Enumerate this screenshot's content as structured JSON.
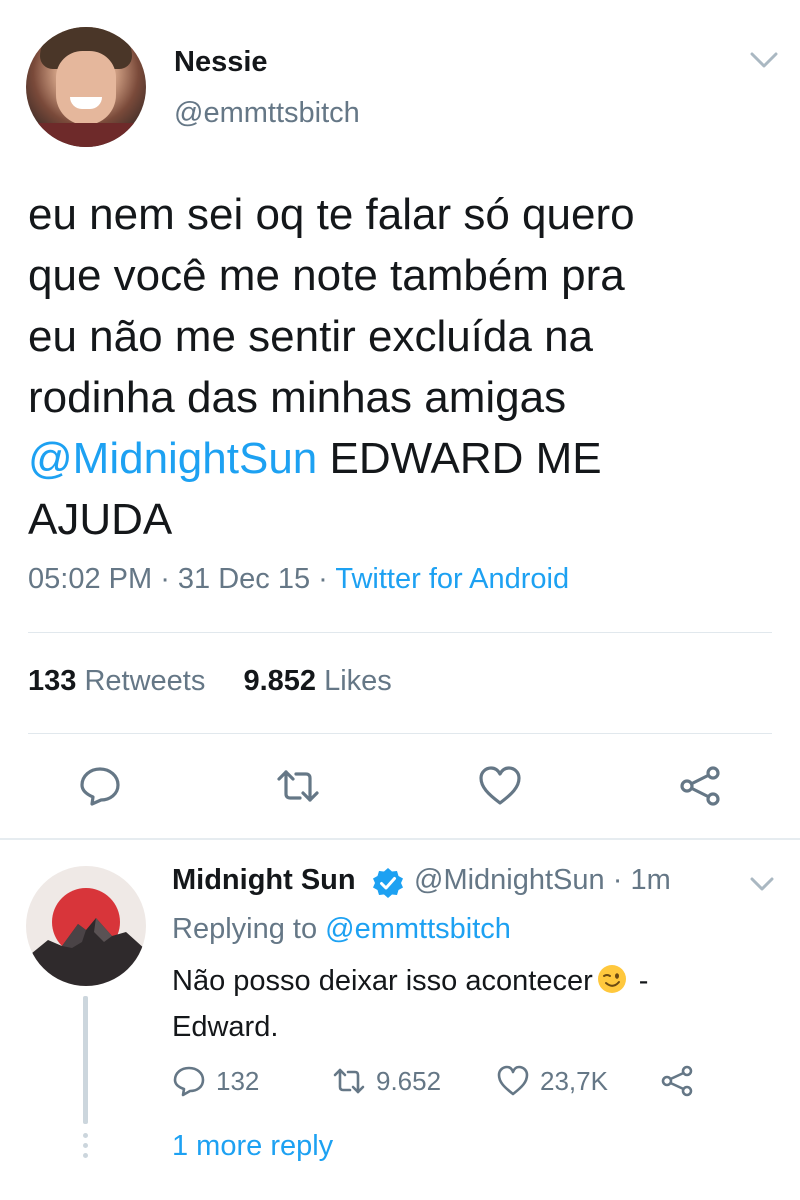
{
  "main_tweet": {
    "author_name": "Nessie",
    "author_handle": "@emmttsbitch",
    "text_before_mention": "eu nem sei oq te falar só quero\nque você me note também pra\neu não me sentir excluída na\nrodinha das minhas amigas\n",
    "mention": "@MidnightSun",
    "text_after_mention": " EDWARD ME\nAJUDA",
    "time": "05:02 PM",
    "date": "31 Dec 15",
    "separator": " · ",
    "source": "Twitter for Android",
    "retweets_count": "133",
    "retweets_label": "Retweets",
    "likes_count": "9.852",
    "likes_label": "Likes",
    "actions": [
      "reply-icon",
      "retweet-icon",
      "like-icon",
      "share-icon"
    ]
  },
  "reply": {
    "author_name": "Midnight Sun",
    "author_handle": "@MidnightSun",
    "time_ago": "1m",
    "meta_separator": " · ",
    "replying_label": "Replying to ",
    "replying_to": "@emmttsbitch",
    "text_before_emoji": "Não posso deixar isso acontecer",
    "emoji": "winking-face",
    "text_after_emoji": " -\nEdward.",
    "reply_count": "132",
    "retweet_count": "9.652",
    "like_count": "23,7K",
    "more_replies": "1 more reply"
  },
  "colors": {
    "accent": "#1da1f2",
    "secondary_text": "#657786",
    "primary_text": "#14171a",
    "divider": "#e1e8ed"
  }
}
